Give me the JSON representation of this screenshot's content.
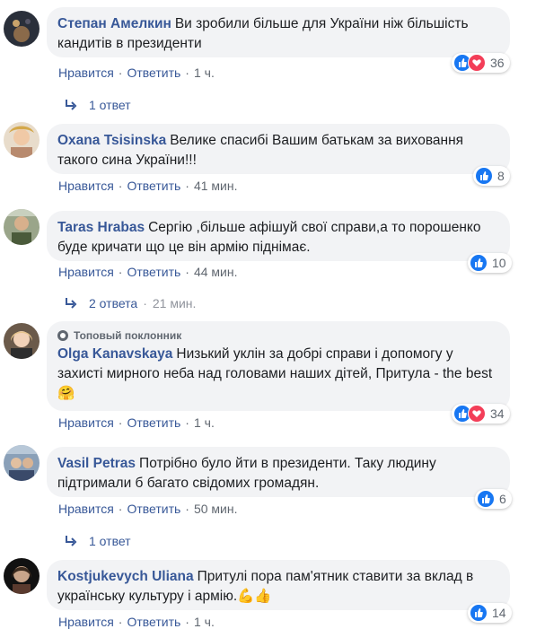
{
  "actions": {
    "like": "Нравится",
    "reply": "Ответить",
    "sep": "·"
  },
  "top_fan_label": "Топовый поклонник",
  "colors": {
    "link": "#385898",
    "like": "#1877f2",
    "love": "#f33e58",
    "bubble": "#f2f3f5"
  },
  "comments": [
    {
      "author": "Степан Амелкин",
      "text": "Ви зробили більше для України ніж більшість кандитів в президенти",
      "time": "1 ч.",
      "reactions": [
        "like",
        "love"
      ],
      "reaction_count": "36",
      "replies": "1 ответ"
    },
    {
      "author": "Oxana Tsisinska",
      "text": "Велике спасибі Вашим батькам за виховання такого сина України!!!",
      "time": "41 мин.",
      "reactions": [
        "like"
      ],
      "reaction_count": "8"
    },
    {
      "author": "Taras Hrabas",
      "text": "Сергію ,більше афішуй свої справи,а то порошенко буде кричати що це він армію піднімає.",
      "time": "44 мин.",
      "reactions": [
        "like"
      ],
      "reaction_count": "10",
      "replies": "2 ответа",
      "replies_time": "21 мин."
    },
    {
      "author": "Olga Kanavskaya",
      "text": "Низький уклін за добрі справи і допомогу у захисті мирного неба над головами наших дітей, Притула - the best 🤗",
      "time": "1 ч.",
      "reactions": [
        "like",
        "love"
      ],
      "reaction_count": "34",
      "top_fan": true
    },
    {
      "author": "Vasil Petras",
      "text": "Потрібно було йти в президенти. Таку людину підтримали б багато свідомих громадян.",
      "time": "50 мин.",
      "reactions": [
        "like"
      ],
      "reaction_count": "6",
      "replies": "1 ответ"
    },
    {
      "author": "Kostjukevych Uliana",
      "text": "Притулі пора пам'ятник ставити за вклад в українську культуру і армію.💪👍",
      "time": "1 ч.",
      "reactions": [
        "like"
      ],
      "reaction_count": "14"
    }
  ]
}
